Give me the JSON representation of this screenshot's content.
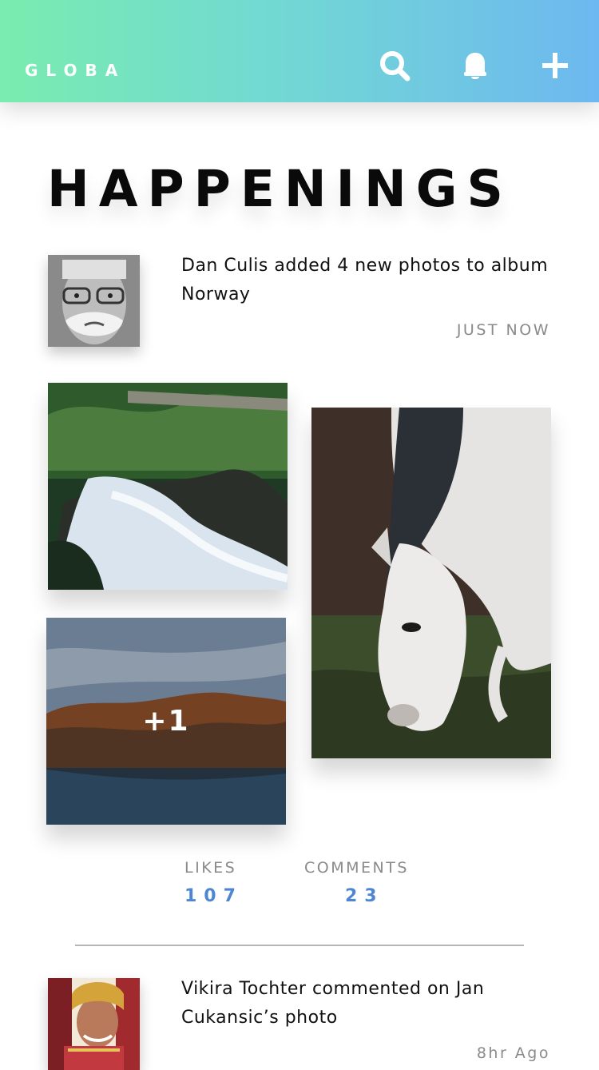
{
  "header": {
    "brand": "GLOBA",
    "icons": [
      "search-icon",
      "bell-icon",
      "plus-icon"
    ],
    "gradient": [
      "#79ecaf",
      "#6db8f0"
    ]
  },
  "page": {
    "title": "HAPPENINGS"
  },
  "feed": [
    {
      "text": "Dan Culis added 4 new photos to album Norway",
      "time": "JUST NOW",
      "photos": [
        "waterfall-photo",
        "lake-photo",
        "horse-photo"
      ],
      "more_count": "+1",
      "likes_label": "LIKES",
      "likes": "107",
      "comments_label": "COMMENTS",
      "comments": "23"
    },
    {
      "text": "Vikira Tochter commented on Jan Cukansic’s photo",
      "time": "8hr Ago"
    }
  ],
  "colors": {
    "accent": "#4f86d4",
    "muted": "#8a8a8a"
  }
}
